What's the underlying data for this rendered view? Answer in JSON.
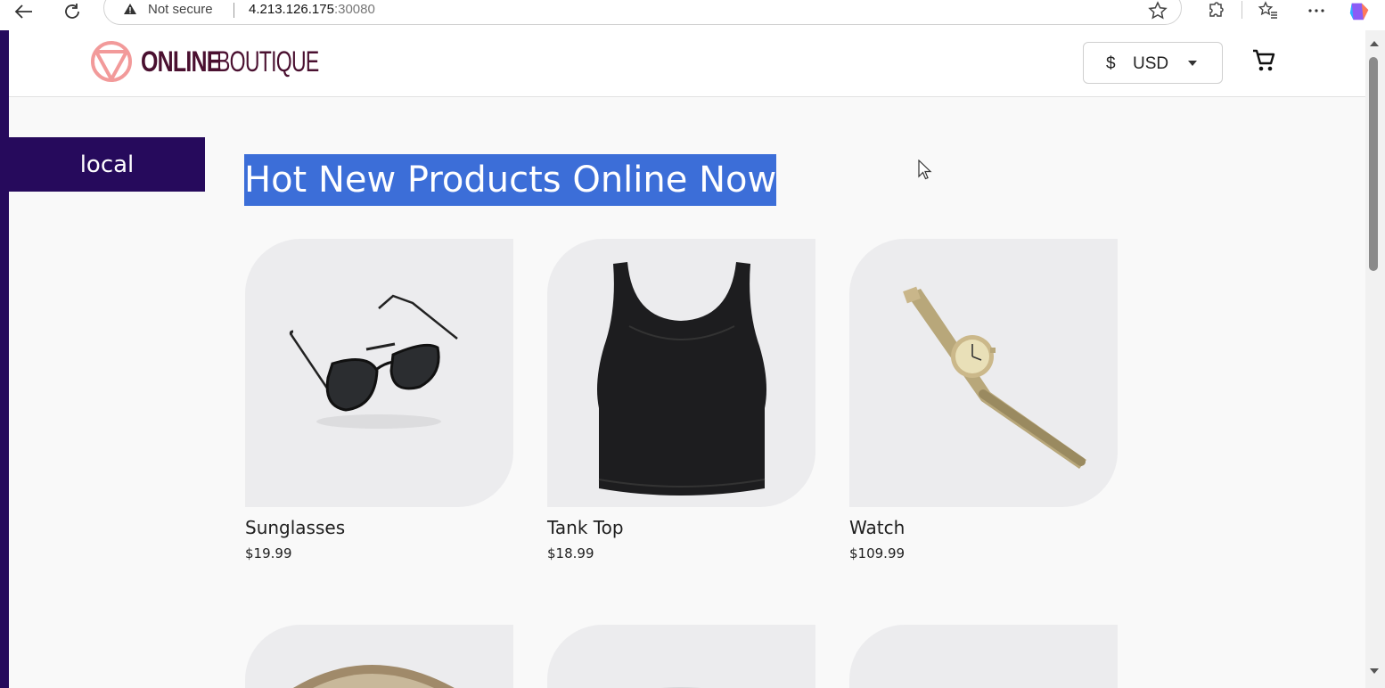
{
  "browser": {
    "security_label": "Not secure",
    "url_host": "4.213.126.175",
    "url_port": ":30080"
  },
  "header": {
    "logo_bold": "ONLINE",
    "logo_thin": "BOUTIQUE",
    "currency_symbol": "$",
    "currency_code": "USD"
  },
  "banner": {
    "label": "local"
  },
  "main": {
    "headline": "Hot New Products Online Now",
    "products": [
      {
        "name": "Sunglasses",
        "price": "$19.99",
        "icon": "sunglasses-image"
      },
      {
        "name": "Tank Top",
        "price": "$18.99",
        "icon": "tank-top-image"
      },
      {
        "name": "Watch",
        "price": "$109.99",
        "icon": "watch-image"
      }
    ]
  },
  "colors": {
    "brand_dark": "#260a5c",
    "logo_mark": "#f29a9a",
    "selection": "#3c6ed8"
  }
}
